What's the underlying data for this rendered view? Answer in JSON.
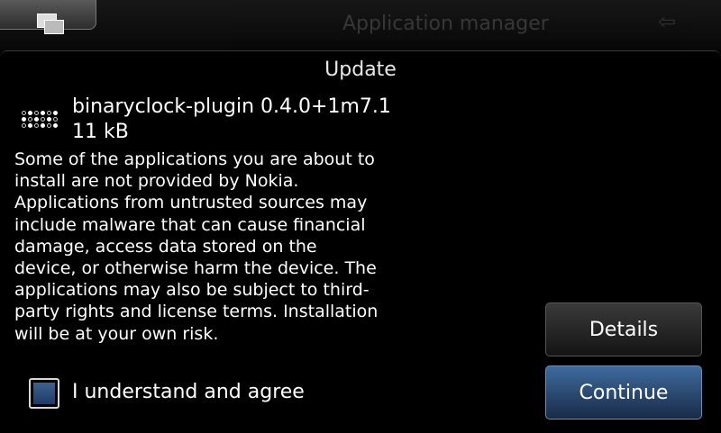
{
  "statusbar": {
    "app_title": "Application manager"
  },
  "dialog": {
    "title": "Update",
    "package_name": "binaryclock-plugin 0.4.0+1m7.1",
    "package_size": "11 kB",
    "warning_text": "Some of the applications you are about to install are not provided by Nokia. Applications from untrusted sources may include malware that can cause financial damage, access data stored on the device, or otherwise harm the device. The applications may also be subject to third-party rights and license terms. Installation will be at your own risk.",
    "agree_label": "I understand and agree",
    "agree_checked": false,
    "details_button": "Details",
    "continue_button": "Continue"
  },
  "colors": {
    "background": "#000000",
    "continue_button": "#2c4f7d",
    "checkbox_fill": "#2f4f7e"
  }
}
